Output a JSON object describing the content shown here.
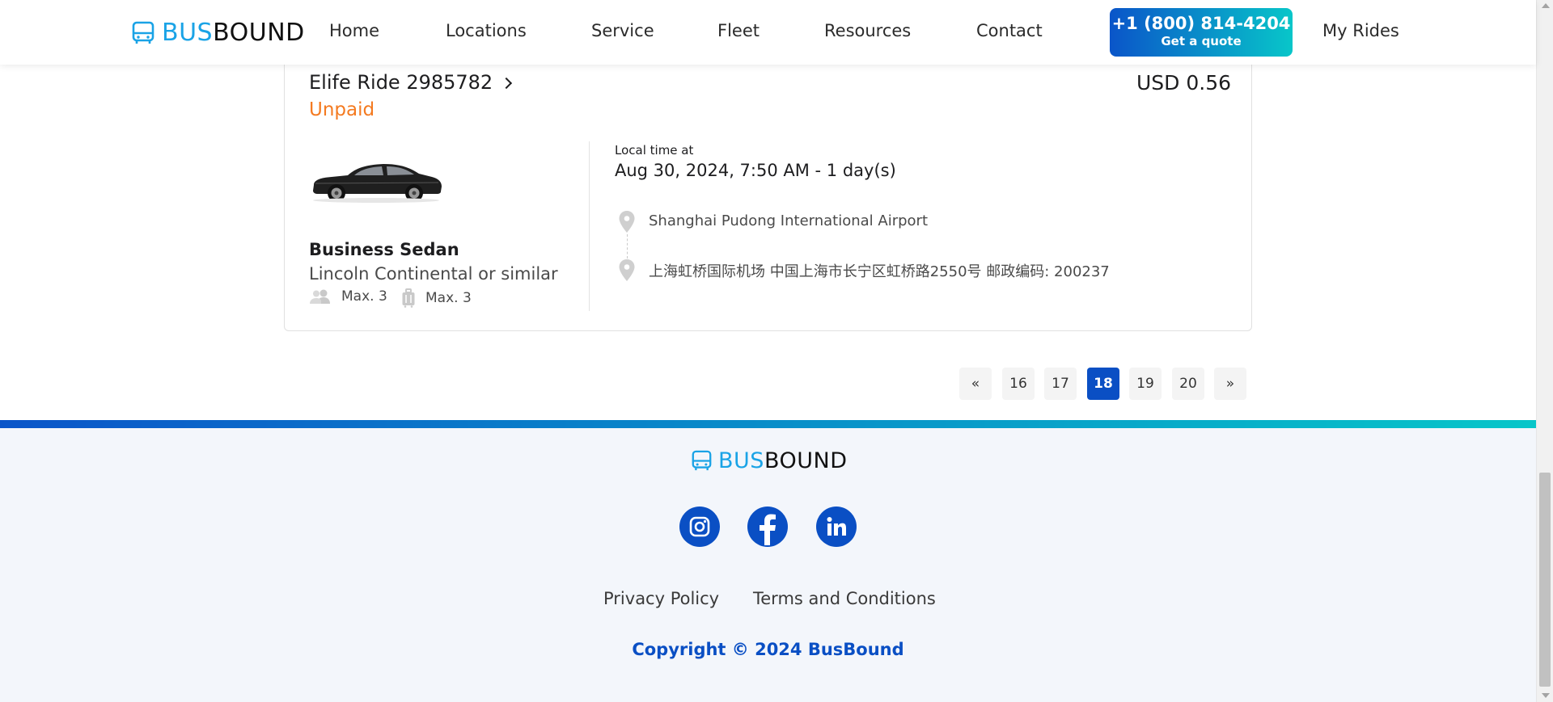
{
  "header": {
    "logo": {
      "part1": "BUS",
      "part2": "BOUND"
    },
    "nav": [
      "Home",
      "Locations",
      "Service",
      "Fleet",
      "Resources",
      "Contact"
    ],
    "cta": {
      "phone": "+1 (800) 814-4204",
      "sub": "Get a quote"
    },
    "my_rides": "My Rides"
  },
  "ride": {
    "title": "Elife Ride 2985782",
    "price": "USD 0.56",
    "status": "Unpaid",
    "vehicle": {
      "name": "Business Sedan",
      "description": "Lincoln Continental or similar",
      "passengers": "Max. 3",
      "luggage": "Max. 3"
    },
    "local_time_label": "Local time at",
    "local_time": "Aug 30, 2024, 7:50 AM - 1 day(s)",
    "pickup": "Shanghai Pudong International Airport",
    "dropoff": "上海虹桥国际机场 中国上海市长宁区虹桥路2550号 邮政编码: 200237"
  },
  "pagination": {
    "prev": "«",
    "pages": [
      "16",
      "17",
      "18",
      "19",
      "20"
    ],
    "current": "18",
    "next": "»"
  },
  "footer": {
    "logo": {
      "part1": "BUS",
      "part2": "BOUND"
    },
    "social": [
      "instagram-icon",
      "facebook-icon",
      "linkedin-icon"
    ],
    "links": [
      "Privacy Policy",
      "Terms and Conditions"
    ],
    "copyright": "Copyright © 2024 BusBound"
  },
  "colors": {
    "brand_blue": "#0a4fc4",
    "brand_cyan": "#08c6c9",
    "logo_light": "#1aa3e6",
    "unpaid": "#f47a20"
  }
}
